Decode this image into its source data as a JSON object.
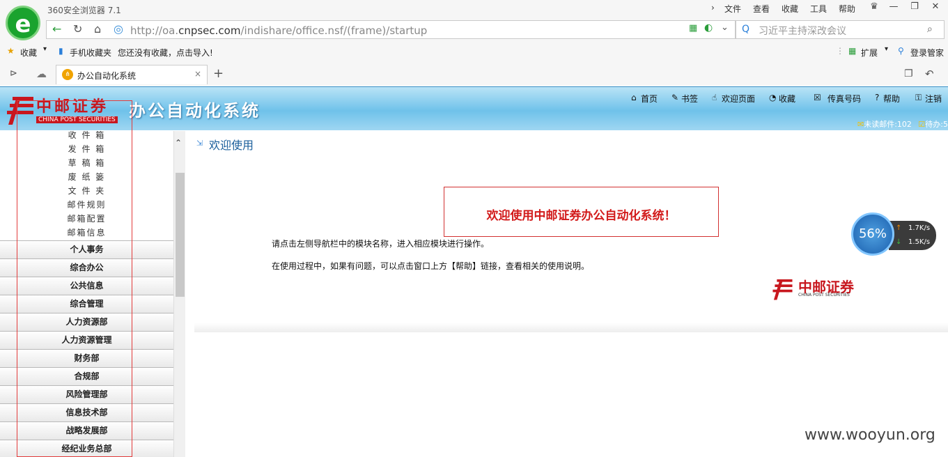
{
  "browser": {
    "app_title": "360安全浏览器 7.1",
    "menu": [
      "文件",
      "查看",
      "收藏",
      "工具",
      "帮助"
    ],
    "url_prefix": "http://oa.",
    "url_domain": "cnpsec.com",
    "url_path": "/indishare/office.nsf/(frame)/startup",
    "search_placeholder": "习近平主持深改会议",
    "bookmark_label": "收藏",
    "mobile_fav": "手机收藏夹",
    "no_fav": "您还没有收藏，点击导入!",
    "extend": "扩展",
    "login": "登录管家",
    "tab_title": "办公自动化系统"
  },
  "app": {
    "cn_name": "中邮证券",
    "en_name": "CHINA POST SECURITIES",
    "system_title": "办公自动化系统",
    "topnav": [
      "首页",
      "书签",
      "欢迎页面",
      "收藏",
      "传真号码",
      "帮助",
      "注销"
    ],
    "unread_mail": "未读邮件:102",
    "todo": "待办:5"
  },
  "leftnav": {
    "subitems": [
      "收 件 箱",
      "发 件 箱",
      "草 稿 箱",
      "废 纸 篓",
      "文 件 夹",
      "邮件规则",
      "邮箱配置",
      "邮箱信息"
    ],
    "items": [
      "个人事务",
      "综合办公",
      "公共信息",
      "综合管理",
      "人力资源部",
      "人力资源管理",
      "财务部",
      "合规部",
      "风险管理部",
      "信息技术部",
      "战略发展部",
      "经纪业务总部"
    ]
  },
  "main": {
    "heading": "欢迎使用",
    "banner": "欢迎使用中邮证券办公自动化系统！",
    "para1": "请点击左侧导航栏中的模块名称，进入相应模块进行操作。",
    "para2": "在使用过程中，如果有问题，可以点击窗口上方【帮助】链接，查看相关的使用说明。",
    "brand_cn": "中邮证券",
    "brand_en": "CHINA POST SECURITIES"
  },
  "speed_widget": {
    "percent": "56%",
    "up": "1.7K/s",
    "down": "1.5K/s"
  },
  "watermark": "www.wooyun.org"
}
